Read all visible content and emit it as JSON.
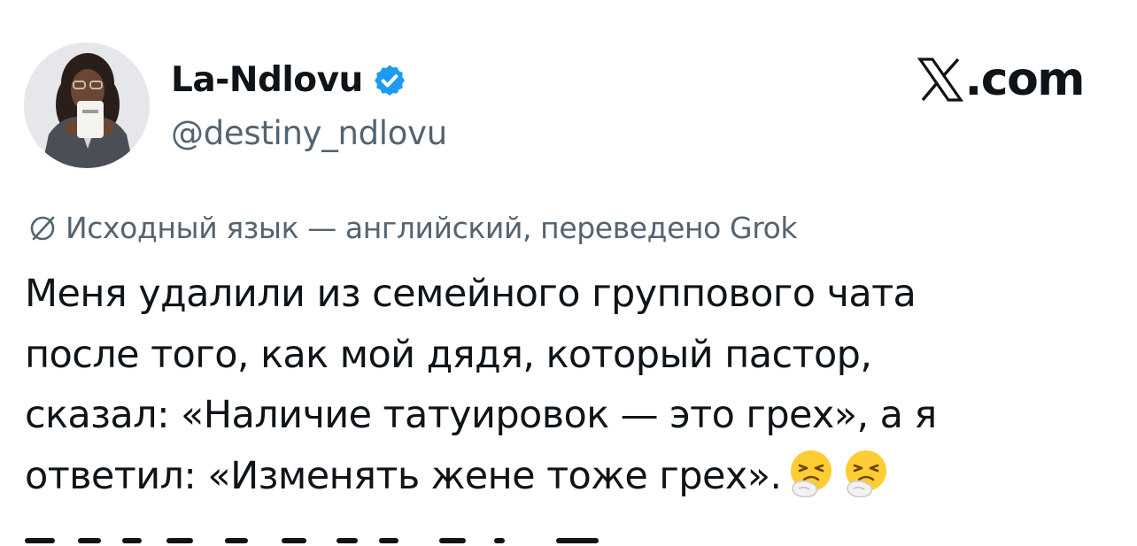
{
  "author": {
    "display_name": "La-Ndlovu",
    "handle": "@destiny_ndlovu",
    "verified": true,
    "verified_color": "#1d9bf0",
    "avatar_icon": "profile-photo"
  },
  "site": {
    "logo_mark": "𝕏",
    "logo_suffix": ".com"
  },
  "translation": {
    "icon": "globe-slash-icon",
    "text": "Исходный язык — английский, переведено Grok"
  },
  "tweet": {
    "lines": [
      "Меня удалили из семейного группового чата",
      "после того, как мой дядя, который пастор,",
      "сказал: «Наличие татуировок — это грех», а я",
      "ответил: «Изменять жене тоже грех»."
    ],
    "trailing_emoji": [
      "sneezing-face",
      "sneezing-face"
    ]
  },
  "colors": {
    "text": "#0f1419",
    "secondary": "#536471",
    "accent": "#1d9bf0"
  }
}
